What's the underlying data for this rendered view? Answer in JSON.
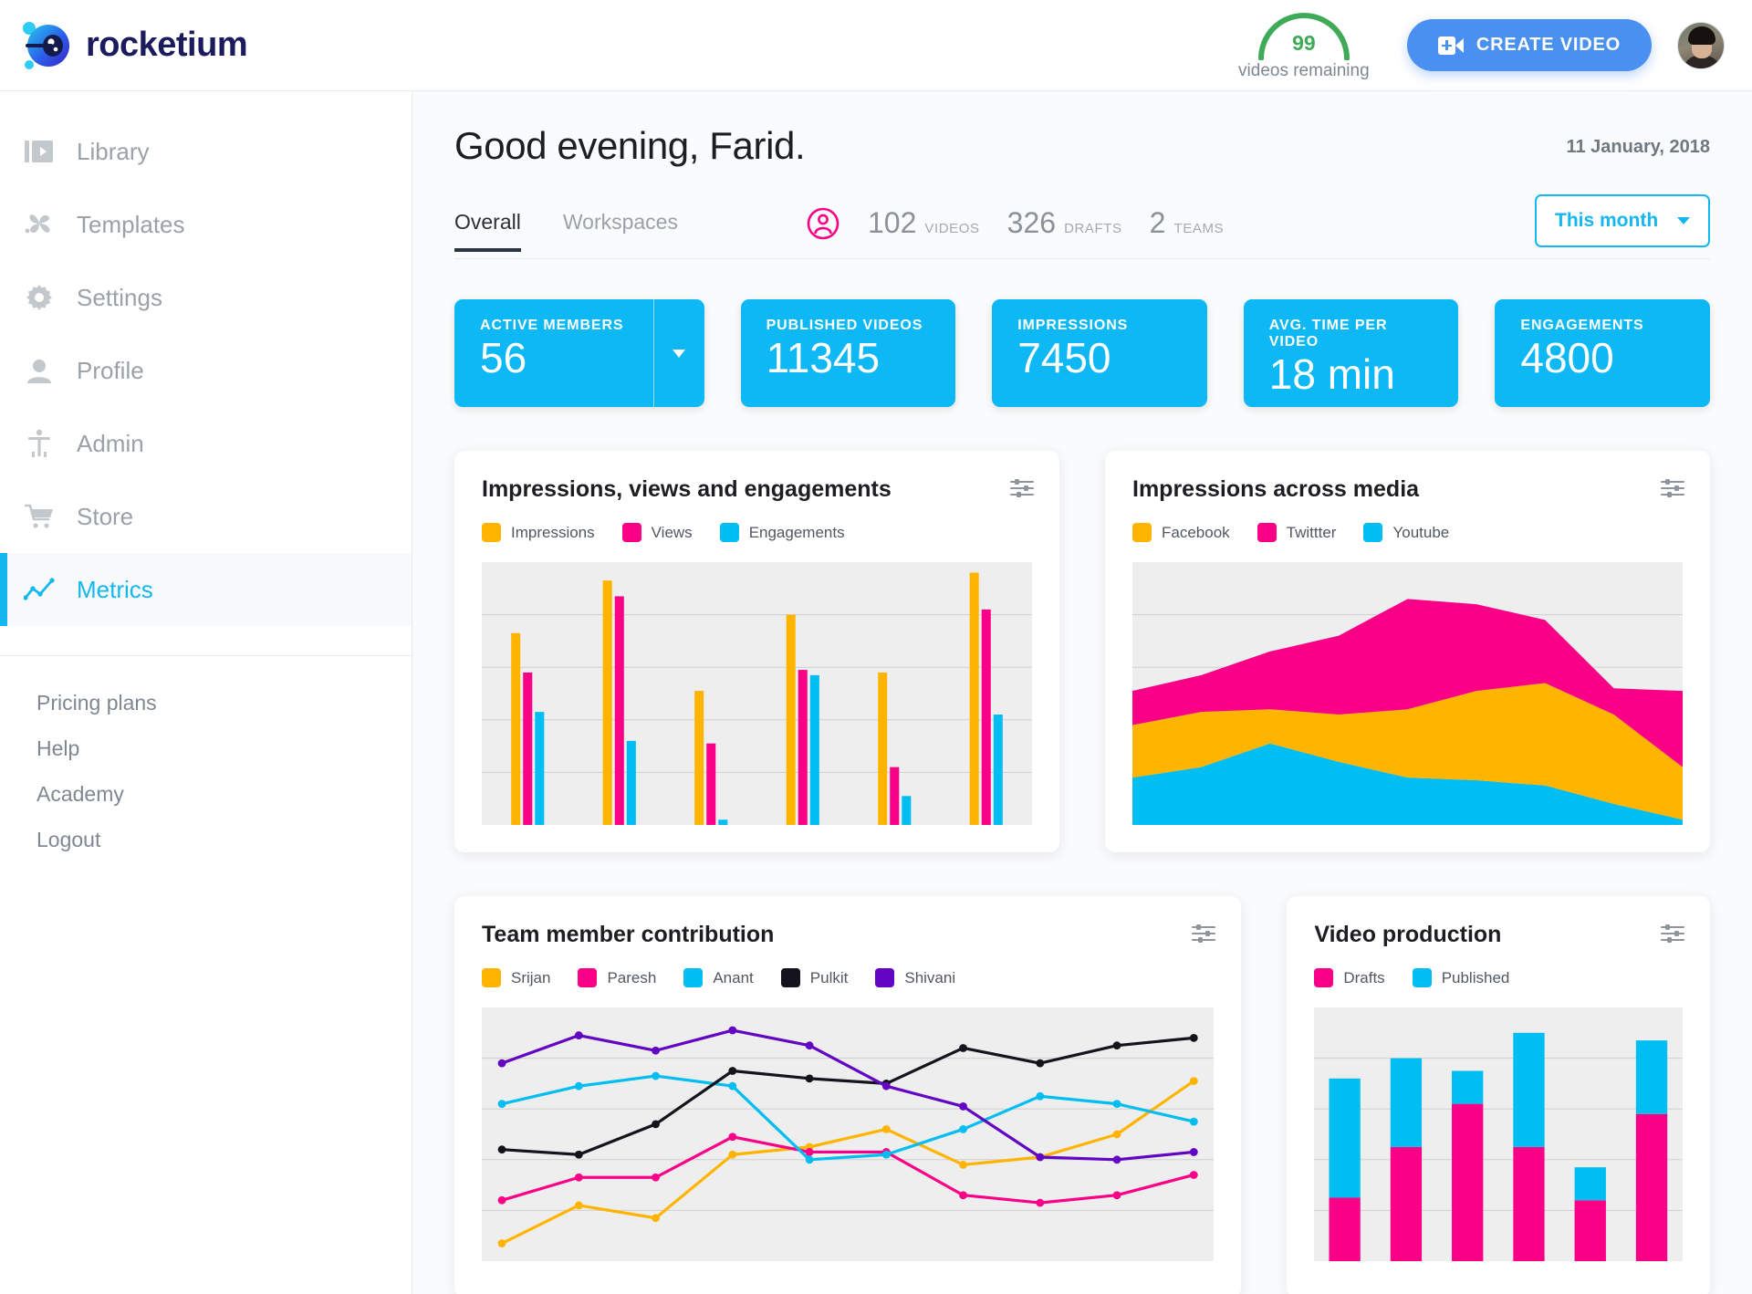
{
  "brand": {
    "name": "rocketium"
  },
  "header": {
    "gauge_value": "99",
    "gauge_label": "videos remaining",
    "gauge_color": "#3faa57",
    "create_button": "CREATE VIDEO",
    "create_button_color": "#4a90f0"
  },
  "sidebar": {
    "items": [
      {
        "label": "Library",
        "icon": "library-icon",
        "active": false
      },
      {
        "label": "Templates",
        "icon": "templates-icon",
        "active": false
      },
      {
        "label": "Settings",
        "icon": "gear-icon",
        "active": false
      },
      {
        "label": "Profile",
        "icon": "person-icon",
        "active": false
      },
      {
        "label": "Admin",
        "icon": "admin-icon",
        "active": false
      },
      {
        "label": "Store",
        "icon": "cart-icon",
        "active": false
      },
      {
        "label": "Metrics",
        "icon": "metrics-icon",
        "active": true
      }
    ],
    "sub_links": [
      "Pricing plans",
      "Help",
      "Academy",
      "Logout"
    ],
    "active_color": "#15b7f0"
  },
  "main": {
    "greeting": "Good evening, Farid.",
    "date": "11 January, 2018",
    "tabs": [
      {
        "label": "Overall",
        "active": true
      },
      {
        "label": "Workspaces",
        "active": false
      }
    ],
    "quick_stats": [
      {
        "value": "102",
        "label": "VIDEOS"
      },
      {
        "value": "326",
        "label": "DRAFTS"
      },
      {
        "value": "2",
        "label": "TEAMS"
      }
    ],
    "period_select": {
      "value": "This month"
    },
    "kpis": [
      {
        "label": "ACTIVE MEMBERS",
        "value": "56",
        "has_dropdown": true
      },
      {
        "label": "PUBLISHED VIDEOS",
        "value": "11345",
        "has_dropdown": false
      },
      {
        "label": "IMPRESSIONS",
        "value": "7450",
        "has_dropdown": false
      },
      {
        "label": "AVG. TIME PER VIDEO",
        "value": "18 min",
        "has_dropdown": false
      },
      {
        "label": "ENGAGEMENTS",
        "value": "4800",
        "has_dropdown": false
      }
    ],
    "kpi_color": "#0db8f5"
  },
  "colors": {
    "amber": "#FFB400",
    "magenta": "#FA0087",
    "cyan": "#00BDF2",
    "black": "#15131c",
    "purple": "#6206C4",
    "plot_bg": "#eeeeee",
    "gridline": "#cfcfcf"
  },
  "chart_data": [
    {
      "id": "impressions-views-engagements",
      "type": "bar",
      "title": "Impressions, views and engagements",
      "xlabel": "",
      "ylabel": "",
      "grid": true,
      "legend_position": "top-left",
      "ylim": [
        0,
        100
      ],
      "categories": [
        "1",
        "2",
        "3",
        "4",
        "5",
        "6"
      ],
      "series": [
        {
          "name": "Impressions",
          "color": "#FFB400",
          "values": [
            73,
            93,
            51,
            80,
            58,
            96
          ]
        },
        {
          "name": "Views",
          "color": "#FA0087",
          "values": [
            58,
            87,
            31,
            59,
            22,
            82
          ]
        },
        {
          "name": "Engagements",
          "color": "#00BDF2",
          "values": [
            43,
            32,
            2,
            57,
            11,
            42
          ]
        }
      ]
    },
    {
      "id": "impressions-across-media",
      "type": "area",
      "title": "Impressions across media",
      "stacked": true,
      "xlabel": "",
      "ylabel": "",
      "grid": true,
      "legend_position": "top-left",
      "ylim": [
        0,
        100
      ],
      "x": [
        "1",
        "2",
        "3",
        "4",
        "5",
        "6",
        "7",
        "8",
        "9"
      ],
      "series": [
        {
          "name": "Youtube",
          "color": "#00BDF2",
          "values": [
            18,
            22,
            31,
            24,
            18,
            17,
            15,
            8,
            2
          ]
        },
        {
          "name": "Facebook",
          "color": "#FFB400",
          "values": [
            20,
            21,
            13,
            18,
            26,
            34,
            39,
            34,
            20
          ]
        },
        {
          "name": "Twittter",
          "color": "#FA0087",
          "values": [
            13,
            14,
            22,
            30,
            42,
            33,
            24,
            10,
            29
          ]
        }
      ]
    },
    {
      "id": "team-member-contribution",
      "type": "line",
      "title": "Team member contribution",
      "markers": true,
      "xlabel": "",
      "ylabel": "",
      "grid": true,
      "legend_position": "top-left",
      "ylim": [
        0,
        100
      ],
      "x": [
        "1",
        "2",
        "3",
        "4",
        "5",
        "6",
        "7",
        "8",
        "9",
        "10"
      ],
      "series": [
        {
          "name": "Srijan",
          "color": "#FFB400",
          "values": [
            7,
            22,
            17,
            42,
            45,
            52,
            38,
            41,
            50,
            71
          ]
        },
        {
          "name": "Paresh",
          "color": "#FA0087",
          "values": [
            24,
            33,
            33,
            49,
            43,
            43,
            26,
            23,
            26,
            34
          ]
        },
        {
          "name": "Anant",
          "color": "#00BDF2",
          "values": [
            62,
            69,
            73,
            69,
            40,
            42,
            52,
            65,
            62,
            55
          ]
        },
        {
          "name": "Pulkit",
          "color": "#15131c",
          "values": [
            44,
            42,
            54,
            75,
            72,
            70,
            84,
            78,
            85,
            88
          ]
        },
        {
          "name": "Shivani",
          "color": "#6206C4",
          "values": [
            78,
            89,
            83,
            91,
            85,
            69,
            61,
            41,
            40,
            43
          ]
        }
      ]
    },
    {
      "id": "video-production",
      "type": "bar",
      "stacked": true,
      "title": "Video production",
      "xlabel": "",
      "ylabel": "",
      "grid": true,
      "legend_position": "top-left",
      "ylim": [
        0,
        100
      ],
      "categories": [
        "1",
        "2",
        "3",
        "4",
        "5",
        "6"
      ],
      "series": [
        {
          "name": "Drafts",
          "color": "#FA0087",
          "values": [
            25,
            45,
            62,
            45,
            24,
            58
          ]
        },
        {
          "name": "Published",
          "color": "#00BDF2",
          "values": [
            47,
            35,
            13,
            45,
            13,
            29
          ]
        }
      ]
    }
  ]
}
